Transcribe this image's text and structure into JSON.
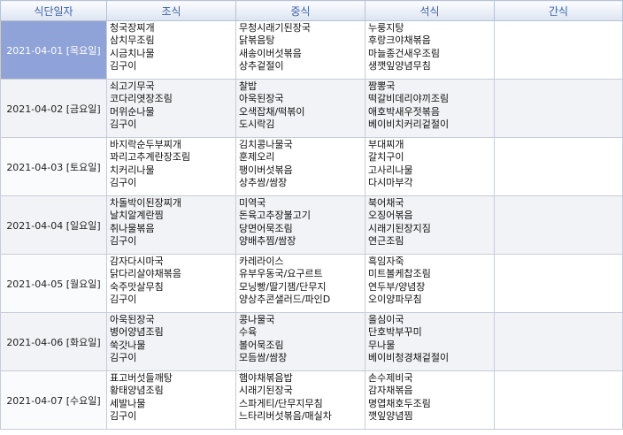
{
  "headers": [
    "식단일자",
    "조식",
    "중식",
    "석식",
    "간식"
  ],
  "rows": [
    {
      "date": "2021-04-01 [목요일]",
      "breakfast": [
        "청국장찌개",
        "삼치무조림",
        "시금치나물",
        "김구이"
      ],
      "lunch": [
        "무청시래기된장국",
        "닭볶음탕",
        "새송이버섯볶음",
        "상추겉절이"
      ],
      "dinner": [
        "누룽지탕",
        "후랑크야채볶음",
        "마늘종건새우조림",
        "생깻잎양념무침"
      ],
      "snack": []
    },
    {
      "date": "2021-04-02 [금요일]",
      "breakfast": [
        "쇠고기무국",
        "코다리엿장조림",
        "머위순나물",
        "김구이"
      ],
      "lunch": [
        "찰밥",
        "아욱된장국",
        "오색잡채/떡볶이",
        "도시락김"
      ],
      "dinner": [
        "짬뽕국",
        "떡갈비데리야끼조림",
        "애호박새우젓볶음",
        "베이비치커리겉절이"
      ],
      "snack": []
    },
    {
      "date": "2021-04-03 [토요일]",
      "breakfast": [
        "바지락순두부찌개",
        "꽈리고추계란장조림",
        "치커리나물",
        "김구이"
      ],
      "lunch": [
        "김치콩나물국",
        "훈제오리",
        "팽이버섯볶음",
        "상추쌈/쌈장"
      ],
      "dinner": [
        "부대찌개",
        "갈치구이",
        "고사리나물",
        "다시마부각"
      ],
      "snack": []
    },
    {
      "date": "2021-04-04 [일요일]",
      "breakfast": [
        "차돌박이된장찌개",
        "날치알계란찜",
        "취나물볶음",
        "김구이"
      ],
      "lunch": [
        "미역국",
        "돈육고추장불고기",
        "당면어묵조림",
        "양배추찜/쌈장"
      ],
      "dinner": [
        "북어채국",
        "오징어볶음",
        "시래기된장지짐",
        "연근조림"
      ],
      "snack": []
    },
    {
      "date": "2021-04-05 [월요일]",
      "breakfast": [
        "감자다시마국",
        "닭다리살야채볶음",
        "숙주맛살무침",
        "김구이"
      ],
      "lunch": [
        "카레라이스",
        "유부우동국/요구르트",
        "모닝빵/딸기잼/단무지",
        "양상추콘샐러드/파인D"
      ],
      "dinner": [
        "흑임자죽",
        "미트볼케찹조림",
        "연두부/양념장",
        "오이양파무침"
      ],
      "snack": []
    },
    {
      "date": "2021-04-06 [화요일]",
      "breakfast": [
        "아욱된장국",
        "병어양념조림",
        "쑥갓나물",
        "김구이"
      ],
      "lunch": [
        "콩나물국",
        "수육",
        "볼어묵조림",
        "모듬쌈/쌈장"
      ],
      "dinner": [
        "올심이국",
        "단호박부꾸미",
        "무나물",
        "베이비청경채겉절이"
      ],
      "snack": []
    },
    {
      "date": "2021-04-07 [수요일]",
      "breakfast": [
        "표고버섯들깨탕",
        "황태양념조림",
        "세발나물",
        "김구이"
      ],
      "lunch": [
        "햄야채볶음밥",
        "시래기된장국",
        "스파게티/단무지무침",
        "느타리버섯볶음/매실차"
      ],
      "dinner": [
        "손수제비국",
        "감자채볶음",
        "명엽채호두조림",
        "깻잎양념찜"
      ],
      "snack": []
    }
  ]
}
